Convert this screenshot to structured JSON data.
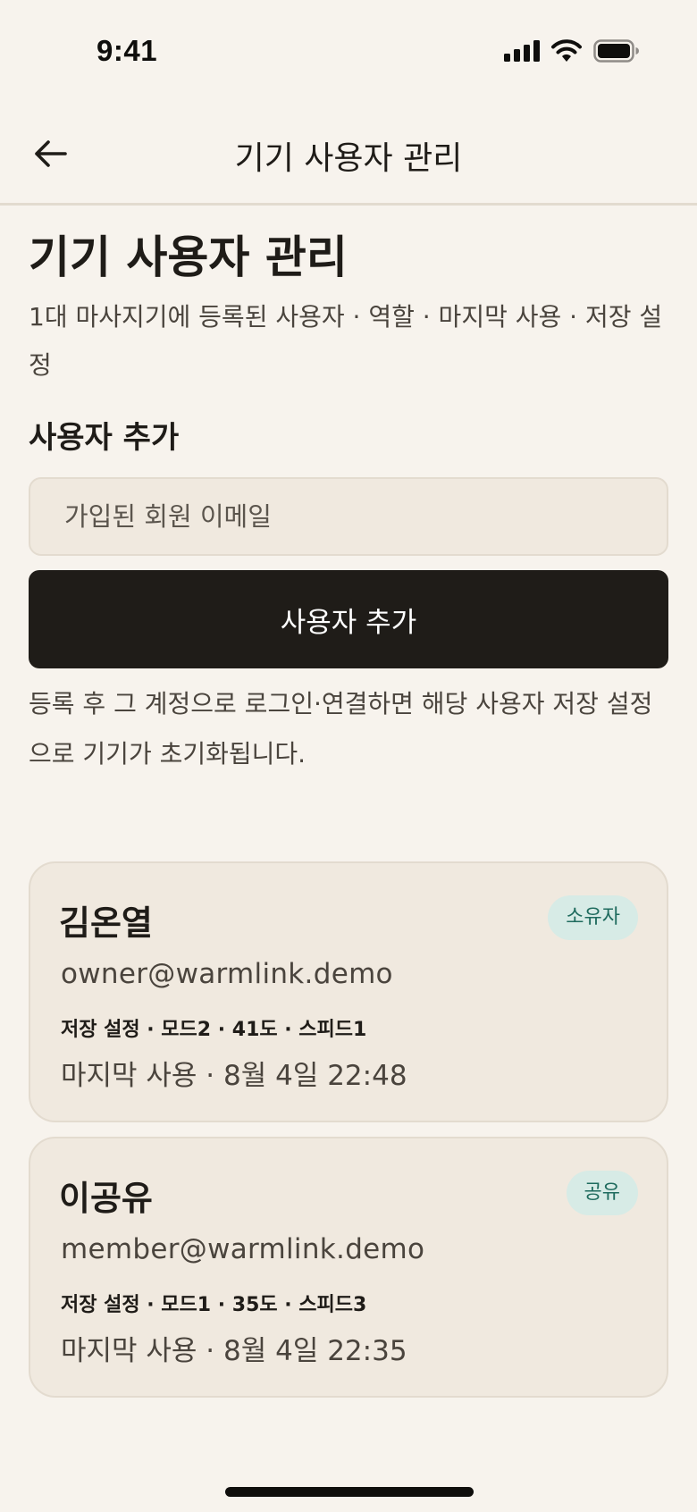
{
  "status_bar": {
    "time": "9:41"
  },
  "nav": {
    "title": "기기 사용자 관리"
  },
  "page": {
    "title": "기기 사용자 관리",
    "subtitle": "1대 마사지기에 등록된 사용자 · 역할 · 마지막 사용 · 저장 설정"
  },
  "add_user": {
    "section_title": "사용자 추가",
    "email_placeholder": "가입된 회원 이메일",
    "email_value": "",
    "button_label": "사용자 추가",
    "helper_text": "등록 후 그 계정으로 로그인·연결하면 해당 사용자 저장 설정으로 기기가 초기화됩니다."
  },
  "users": [
    {
      "name": "김온열",
      "role": "소유자",
      "email": "owner@warmlink.demo",
      "settings": "저장 설정 · 모드2 · 41도 · 스피드1",
      "last_used": "마지막 사용 · 8월 4일 22:48"
    },
    {
      "name": "이공유",
      "role": "공유",
      "email": "member@warmlink.demo",
      "settings": "저장 설정 · 모드1 · 35도 · 스피드3",
      "last_used": "마지막 사용 · 8월 4일 22:35"
    }
  ],
  "colors": {
    "background": "#f7f3ed",
    "card": "#f0e9df",
    "primary_button": "#1f1c18",
    "badge_bg": "#d7ebe6",
    "badge_text": "#1f6b5e"
  }
}
